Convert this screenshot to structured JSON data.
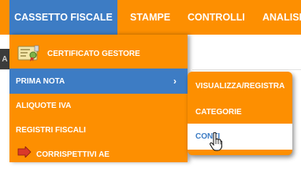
{
  "nav": {
    "items": [
      {
        "label": "CASSETTO FISCALE",
        "active": true
      },
      {
        "label": "STAMPE"
      },
      {
        "label": "CONTROLLI"
      },
      {
        "label": "ANALISI"
      }
    ]
  },
  "page": {
    "left_tab_text": "A"
  },
  "menu": {
    "items": [
      {
        "label": "CERTIFICATO GESTORE",
        "icon": "certificate-icon"
      },
      {
        "label": "PRIMA NOTA",
        "highlighted": true,
        "submenu_indicator": "›"
      },
      {
        "label": "ALIQUOTE IVA"
      },
      {
        "label": "REGISTRI FISCALI"
      },
      {
        "label": "CORRISPETTIVI AE",
        "icon": "arrow-icon"
      }
    ]
  },
  "submenu": {
    "items": [
      {
        "label": "VISUALIZZA/REGISTRA"
      },
      {
        "label": "CATEGORIE"
      },
      {
        "label": "CONTI",
        "hovered": true
      }
    ]
  },
  "colors": {
    "orange": "#fd8f01",
    "blue": "#3d7cc4",
    "white": "#ffffff"
  }
}
